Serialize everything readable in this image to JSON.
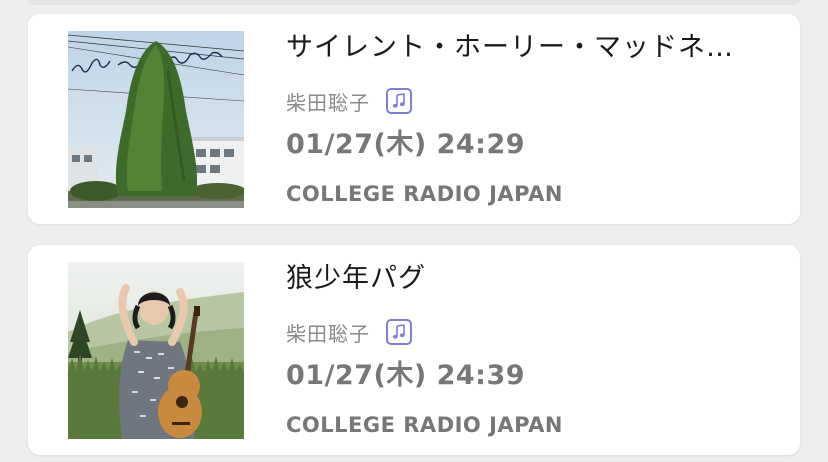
{
  "playlist": [
    {
      "title": "サイレント・ホーリー・マッドネ…",
      "artist": "柴田聡子",
      "badge_icon": "music-note-icon",
      "air_time": "01/27(木) 24:29",
      "station": "COLLEGE RADIO JAPAN",
      "artwork": "album-cover-tree"
    },
    {
      "title": "狼少年パグ",
      "artist": "柴田聡子",
      "badge_icon": "music-note-icon",
      "air_time": "01/27(木) 24:39",
      "station": "COLLEGE RADIO JAPAN",
      "artwork": "album-cover-guitar-portrait"
    }
  ],
  "colors": {
    "background": "#eeeeee",
    "card": "#ffffff",
    "title_text": "#1a1a1a",
    "muted_text": "#777777",
    "badge": "#7b7fd6"
  }
}
